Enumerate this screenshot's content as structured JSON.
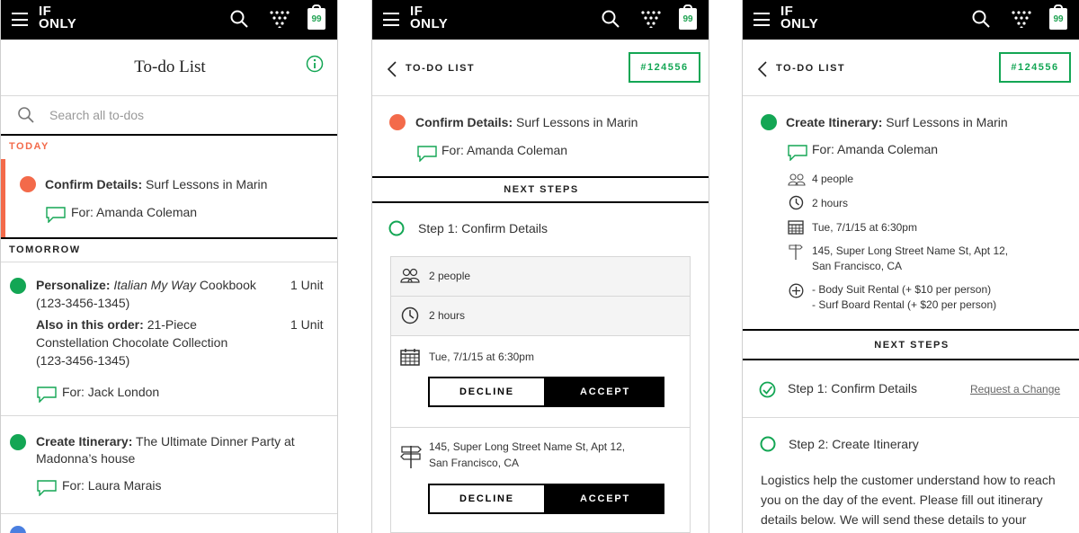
{
  "app": {
    "logo_line1": "IF",
    "logo_line2": "ONLY",
    "cart_count": "99"
  },
  "screen1": {
    "title": "To-do List",
    "search_placeholder": "Search all to-dos",
    "today_label": "TODAY",
    "tomorrow_label": "TOMORROW",
    "today_item": {
      "prefix": "Confirm Details:",
      "text": "Surf Lessons in Marin",
      "for": "For: Amanda Coleman"
    },
    "item1": {
      "prefix": "Personalize:",
      "title_italic": "Italian My Way",
      "title_rest": "Cookbook",
      "line2": "(123-3456-1345)",
      "qty": "1 Unit",
      "also_prefix": "Also in this order:",
      "also_text": "21-Piece",
      "also_line2": "Constellation Chocolate Collection",
      "also_line3": "(123-3456-1345)",
      "also_qty": "1 Unit",
      "for": "For: Jack London"
    },
    "item2": {
      "prefix": "Create Itinerary:",
      "text": "The Ultimate Dinner Party at",
      "line2": "Madonna’s house",
      "for": "For: Laura Marais"
    }
  },
  "screen2": {
    "back_label": "TO-DO LIST",
    "order_id": "#124556",
    "item": {
      "prefix": "Confirm Details:",
      "text": "Surf Lessons in Marin",
      "for": "For: Amanda Coleman"
    },
    "next_steps": "NEXT STEPS",
    "step1": "Step 1: Confirm Details",
    "people": "2 people",
    "duration": "2 hours",
    "date": "Tue, 7/1/15 at 6:30pm",
    "address_line1": "145, Super Long Street Name St, Apt 12,",
    "address_line2": "San Francisco, CA",
    "decline": "DECLINE",
    "accept": "ACCEPT"
  },
  "screen3": {
    "back_label": "TO-DO LIST",
    "order_id": "#124556",
    "item": {
      "prefix": "Create Itinerary:",
      "text": "Surf Lessons in Marin",
      "for": "For: Amanda Coleman"
    },
    "people": "4 people",
    "duration": "2 hours",
    "date": "Tue, 7/1/15 at 6:30pm",
    "address_line1": "145, Super Long Street Name St, Apt 12,",
    "address_line2": "San Francisco, CA",
    "addon1": "- Body Suit Rental  (+ $10 per person)",
    "addon2": "- Surf Board Rental (+ $20 per person)",
    "next_steps": "NEXT STEPS",
    "step1": "Step 1: Confirm Details",
    "request_change": "Request a Change",
    "step2": "Step 2: Create Itinerary",
    "body_line1": "Logistics help the customer understand how to reach",
    "body_line2": "you on the day of the event. Please fill out itinerary",
    "body_line3": "details below. We will send these details to your"
  },
  "colors": {
    "accent_green": "#13a654",
    "alert_orange": "#f36a4a",
    "bar_black": "#000000"
  }
}
